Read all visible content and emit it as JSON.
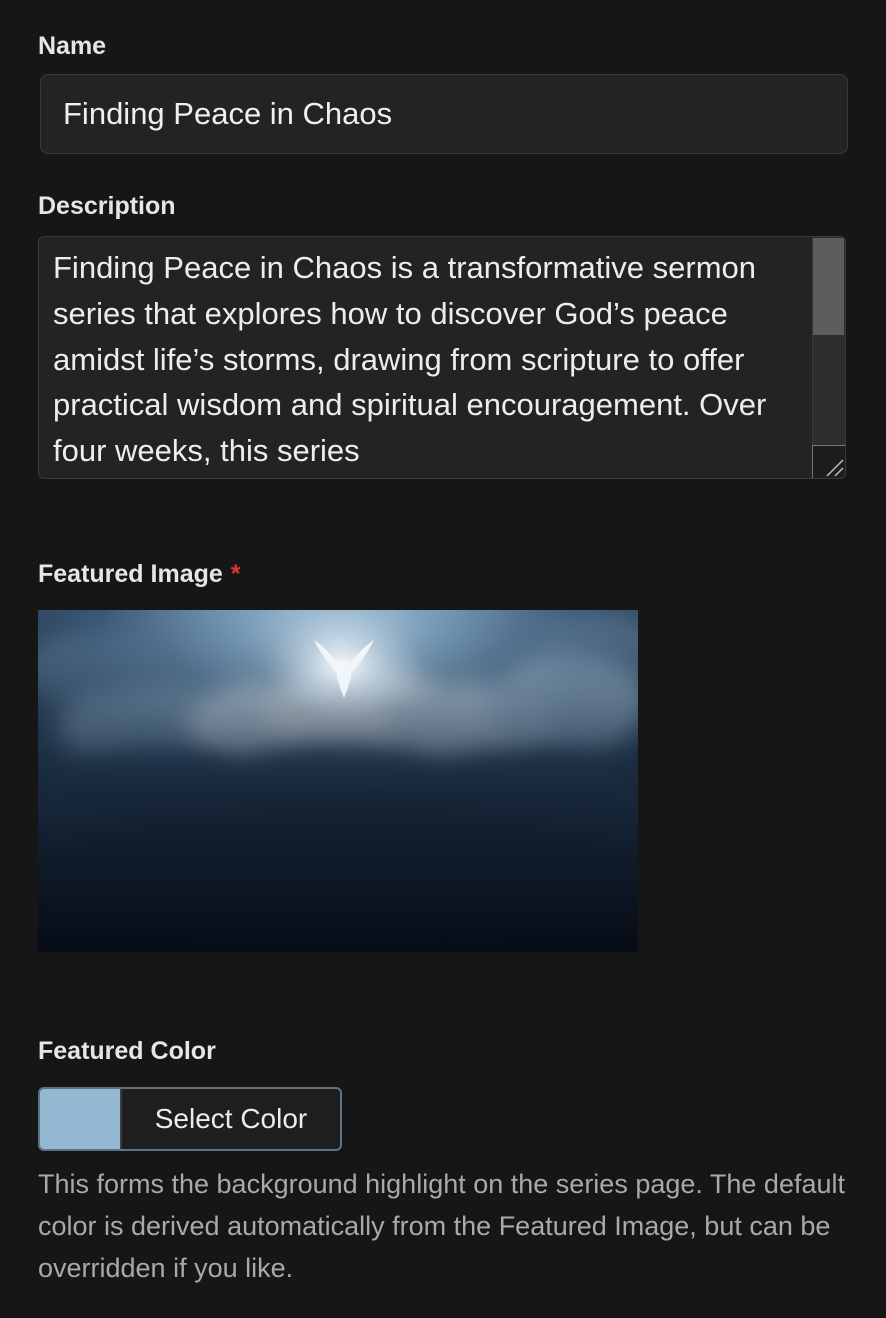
{
  "name": {
    "label": "Name",
    "value": "Finding Peace in Chaos"
  },
  "description": {
    "label": "Description",
    "value": "Finding Peace in Chaos is a transformative sermon series that explores how to discover God’s peace amidst life’s storms, drawing from scripture to offer practical wisdom and spiritual encouragement. Over four weeks, this series"
  },
  "featured_image": {
    "label": "Featured Image",
    "required_marker": "*"
  },
  "featured_color": {
    "label": "Featured Color",
    "button_label": "Select Color",
    "swatch_color": "#93b8d2",
    "help_text": "This forms the background highlight on the series page. The default color is derived automatically from the Featured Image, but can be overridden if you like."
  },
  "colors": {
    "background": "#161616",
    "input_background": "#232323",
    "required": "#e0352e"
  }
}
